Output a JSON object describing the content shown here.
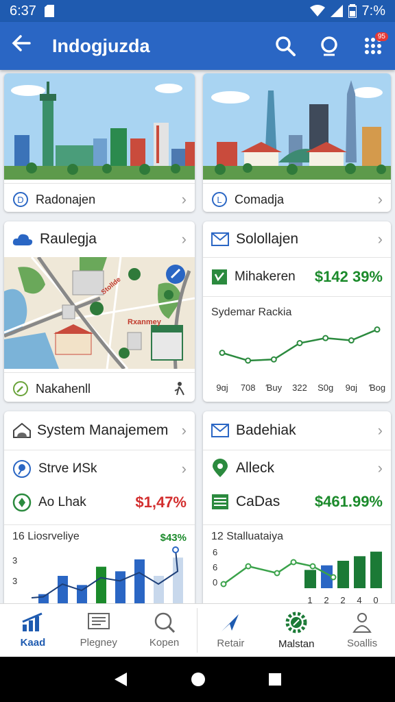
{
  "status": {
    "time": "6:37",
    "battery": "7:%"
  },
  "appbar": {
    "title": "Indogjuzda",
    "badge": "95"
  },
  "cards": {
    "city1": {
      "label": "Radonajen"
    },
    "city2": {
      "label": "Comadja"
    },
    "map": {
      "title": "Raulegja",
      "footer": "Nakahenll",
      "street1": "Rxanmey",
      "street2": "Stollde"
    },
    "sales": {
      "title": "Solollajen",
      "row_label": "Mihakeren",
      "row_value": "$142 39%",
      "chart_title": "Sydemar Rackia",
      "x_labels": [
        "9ɑj",
        "708",
        "Ɓuy",
        "322",
        "S0g",
        "9ɑj",
        "Ɓog"
      ]
    },
    "system": {
      "title": "System Manajemem",
      "row1": "Strve ИSk",
      "row2": "Ao Lhak",
      "row2_value": "$1,47%",
      "chart_title": "16 Liosrveliye",
      "chart_value": "$43%",
      "y_labels": [
        "3",
        "3"
      ]
    },
    "badehiak": {
      "title": "Badehiak",
      "row1": "Alleck",
      "row2": "CaDas",
      "row2_value": "$461.99%",
      "chart_title": "12 Stalluataiya",
      "y_labels": [
        "6",
        "6",
        "0"
      ],
      "x_labels": [
        "1",
        "2",
        "2",
        "4",
        "0"
      ]
    }
  },
  "chart_data": [
    {
      "type": "line",
      "title": "Sydemar Rackia",
      "x": [
        "9ɑj",
        "708",
        "Ɓuy",
        "322",
        "S0g",
        "9ɑj",
        "Ɓog"
      ],
      "series": [
        {
          "values": [
            5,
            3,
            3.3,
            7.5,
            8.8,
            8.2,
            11
          ]
        }
      ]
    },
    {
      "type": "bar",
      "title": "16 Liosrveliye",
      "series": [
        {
          "values": [
            1,
            3,
            2,
            4,
            3.5,
            4.8,
            3,
            5
          ]
        }
      ]
    },
    {
      "type": "bar",
      "title": "12 Stalluataiya",
      "categories": [
        "1",
        "2",
        "2",
        "4",
        "0"
      ],
      "series": [
        {
          "values": [
            4,
            5,
            6,
            7,
            8
          ]
        }
      ]
    }
  ],
  "bottomnav": [
    "Kaad",
    "Plegney",
    "Kopen",
    "Retair",
    "Malstan",
    "Soallis"
  ],
  "colors": {
    "primary": "#2a66c4",
    "green": "#1b8a2b",
    "red": "#d32f2f"
  }
}
